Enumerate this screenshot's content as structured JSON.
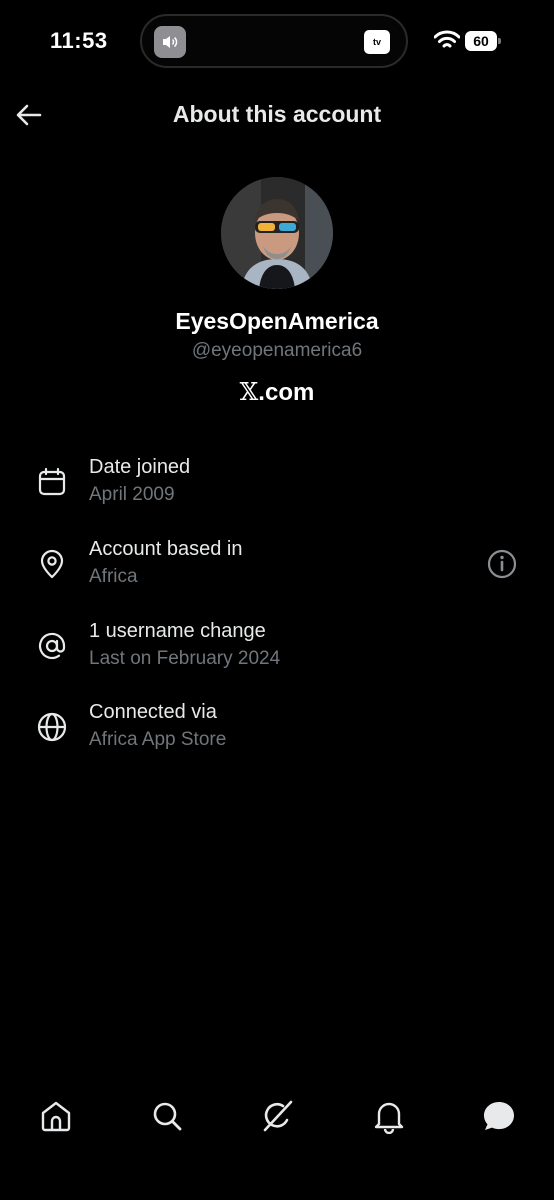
{
  "status_bar": {
    "time": "11:53",
    "battery": "60",
    "live_activity_badge": "tv"
  },
  "header": {
    "title": "About this account",
    "back_icon": "arrow-left-icon"
  },
  "profile": {
    "display_name": "EyesOpenAmerica",
    "handle": "@eyeopenamerica6",
    "site_prefix": "𝕏",
    "site_suffix": ".com"
  },
  "info": [
    {
      "icon": "calendar-icon",
      "label": "Date joined",
      "value": "April 2009"
    },
    {
      "icon": "location-pin-icon",
      "label": "Account based in",
      "value": "Africa"
    },
    {
      "icon": "at-sign-icon",
      "label": "1 username change",
      "value": "Last on February 2024"
    },
    {
      "icon": "globe-icon",
      "label": "Connected via",
      "value": "Africa App Store"
    }
  ],
  "tab_bar": {
    "items": [
      "home-icon",
      "search-icon",
      "grok-icon",
      "notifications-icon",
      "messages-icon"
    ]
  },
  "colors": {
    "background": "#000000",
    "primary_text": "#e7e9ea",
    "secondary_text": "#71767b"
  }
}
